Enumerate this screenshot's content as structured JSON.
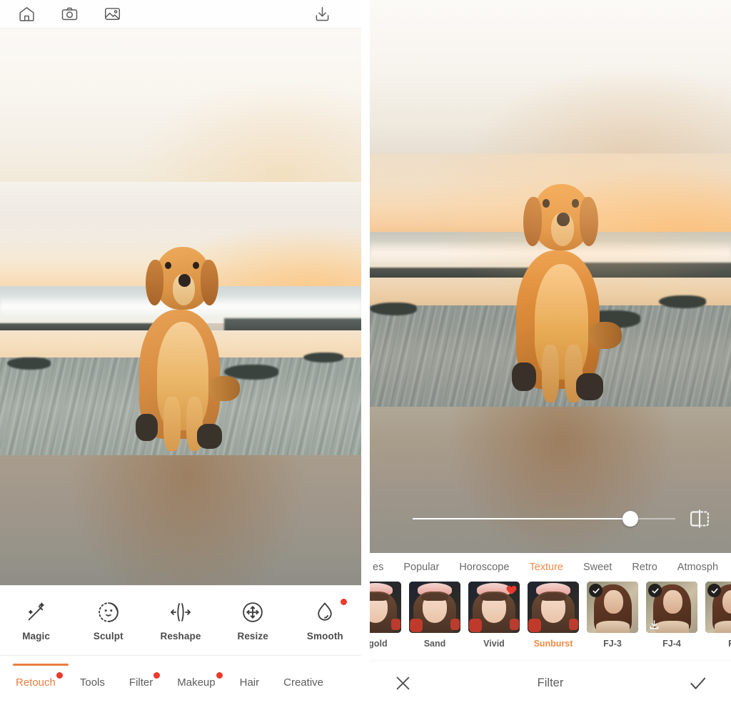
{
  "app": {
    "left_screen": {
      "topbar": {
        "icons": [
          {
            "name": "home-icon",
            "label": "Home"
          },
          {
            "name": "camera-icon",
            "label": "Camera"
          },
          {
            "name": "gallery-icon",
            "label": "Gallery"
          }
        ],
        "save_icon": {
          "name": "download-icon",
          "label": "Save"
        }
      },
      "tools": [
        {
          "label": "Magic",
          "icon": "magic-wand-icon",
          "badge": false
        },
        {
          "label": "Sculpt",
          "icon": "face-sculpt-icon",
          "badge": false
        },
        {
          "label": "Reshape",
          "icon": "reshape-icon",
          "badge": false
        },
        {
          "label": "Resize",
          "icon": "resize-icon",
          "badge": false
        },
        {
          "label": "Smooth",
          "icon": "smooth-droplet-icon",
          "badge": true
        }
      ],
      "tabs": [
        {
          "label": "Retouch",
          "active": true,
          "badge": true
        },
        {
          "label": "Tools",
          "active": false,
          "badge": false
        },
        {
          "label": "Filter",
          "active": false,
          "badge": true
        },
        {
          "label": "Makeup",
          "active": false,
          "badge": true
        },
        {
          "label": "Hair",
          "active": false,
          "badge": false
        },
        {
          "label": "Creative",
          "active": false,
          "badge": false
        }
      ]
    },
    "right_screen": {
      "slider": {
        "value": 83,
        "min": 0,
        "max": 100
      },
      "compare_icon": "compare-split-icon",
      "categories": [
        {
          "label": "es",
          "active": false,
          "clipped": true
        },
        {
          "label": "Popular",
          "active": false
        },
        {
          "label": "Horoscope",
          "active": false
        },
        {
          "label": "Texture",
          "active": true
        },
        {
          "label": "Sweet",
          "active": false
        },
        {
          "label": "Retro",
          "active": false
        },
        {
          "label": "Atmosph",
          "active": false,
          "clipped": true
        }
      ],
      "filters": [
        {
          "name": "egold",
          "style": "portrait-dark",
          "selected": false,
          "heart": false,
          "check": false,
          "download": false,
          "clipped": true
        },
        {
          "name": "Sand",
          "style": "portrait-dark",
          "selected": false,
          "heart": false,
          "check": false,
          "download": false
        },
        {
          "name": "Vivid",
          "style": "portrait-dark",
          "selected": false,
          "heart": true,
          "check": false,
          "download": false
        },
        {
          "name": "Sunburst",
          "style": "portrait-dark",
          "selected": true,
          "heart": false,
          "check": false,
          "download": false
        },
        {
          "name": "FJ-3",
          "style": "portrait-light",
          "selected": false,
          "heart": false,
          "check": true,
          "download": false
        },
        {
          "name": "FJ-4",
          "style": "portrait-light",
          "selected": false,
          "heart": false,
          "check": true,
          "download": true
        },
        {
          "name": "F",
          "style": "portrait-light",
          "selected": false,
          "heart": false,
          "check": true,
          "download": false,
          "clipped": true
        }
      ],
      "actionbar": {
        "cancel_icon": "close-icon",
        "title": "Filter",
        "confirm_icon": "check-icon"
      }
    }
  },
  "theme": {
    "accent": "#eb7e3f",
    "accent_light": "#f08a43",
    "badge_red": "#ec3a2b",
    "text": "#5c5c5c",
    "icon_stroke": "#585858",
    "background": "#ffffff"
  },
  "photo": {
    "subject": "golden-retriever-on-beach",
    "scene": "sunset beach with ocean and sand"
  }
}
